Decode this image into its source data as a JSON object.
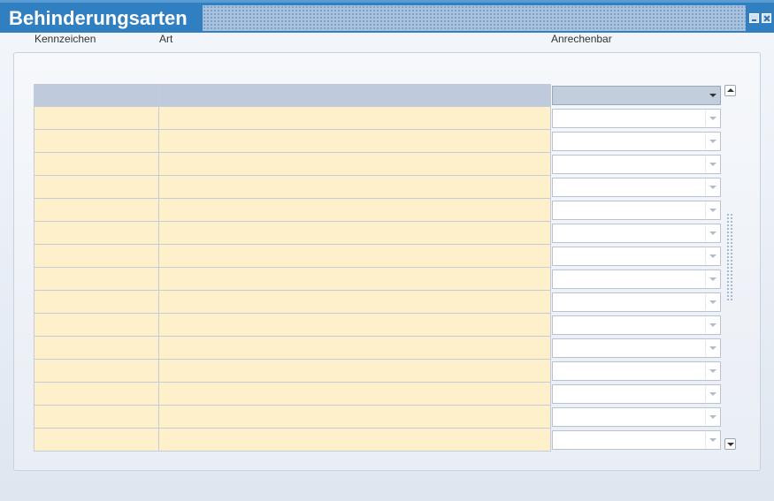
{
  "window": {
    "title": "Behinderungsarten"
  },
  "table": {
    "columns": {
      "kennzeichen": "Kennzeichen",
      "art": "Art",
      "anrechenbar": "Anrechenbar"
    },
    "rows": [
      {
        "kennzeichen": "",
        "art": "",
        "anrechenbar": "",
        "current": true
      },
      {
        "kennzeichen": "",
        "art": "",
        "anrechenbar": ""
      },
      {
        "kennzeichen": "",
        "art": "",
        "anrechenbar": ""
      },
      {
        "kennzeichen": "",
        "art": "",
        "anrechenbar": ""
      },
      {
        "kennzeichen": "",
        "art": "",
        "anrechenbar": ""
      },
      {
        "kennzeichen": "",
        "art": "",
        "anrechenbar": ""
      },
      {
        "kennzeichen": "",
        "art": "",
        "anrechenbar": ""
      },
      {
        "kennzeichen": "",
        "art": "",
        "anrechenbar": ""
      },
      {
        "kennzeichen": "",
        "art": "",
        "anrechenbar": ""
      },
      {
        "kennzeichen": "",
        "art": "",
        "anrechenbar": ""
      },
      {
        "kennzeichen": "",
        "art": "",
        "anrechenbar": ""
      },
      {
        "kennzeichen": "",
        "art": "",
        "anrechenbar": ""
      },
      {
        "kennzeichen": "",
        "art": "",
        "anrechenbar": ""
      },
      {
        "kennzeichen": "",
        "art": "",
        "anrechenbar": ""
      },
      {
        "kennzeichen": "",
        "art": "",
        "anrechenbar": ""
      },
      {
        "kennzeichen": "",
        "art": "",
        "anrechenbar": ""
      }
    ]
  },
  "icons": {
    "minimize": "minimize-icon",
    "close": "close-icon",
    "dropdown": "chevron-down-icon",
    "scroll_up": "arrow-up-icon",
    "scroll_down": "arrow-down-icon"
  },
  "colors": {
    "titlebar": "#2f7fc1",
    "cell_fill": "#fff0cc",
    "current_row": "#bfcbdc"
  }
}
